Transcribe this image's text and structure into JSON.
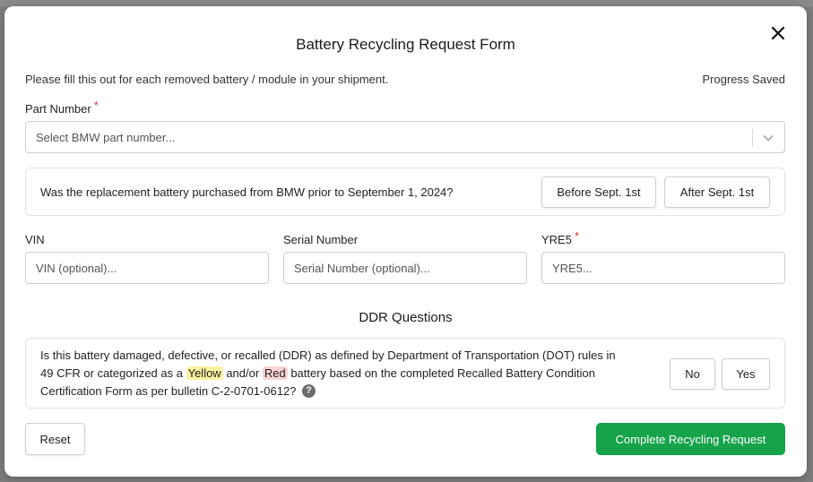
{
  "modal": {
    "title": "Battery Recycling Request Form",
    "subtitle": "Please fill this out for each removed battery / module in your shipment.",
    "progress": "Progress Saved"
  },
  "part_number": {
    "label": "Part Number",
    "required": "*",
    "placeholder": "Select BMW part number..."
  },
  "purchase_question": {
    "text": "Was the replacement battery purchased from BMW prior to September 1, 2024?",
    "before_label": "Before Sept. 1st",
    "after_label": "After Sept. 1st"
  },
  "vin": {
    "label": "VIN",
    "placeholder": "VIN (optional)..."
  },
  "serial": {
    "label": "Serial Number",
    "placeholder": "Serial Number (optional)..."
  },
  "yre5": {
    "label": "YRE5",
    "required": "*",
    "placeholder": "YRE5..."
  },
  "ddr": {
    "section_title": "DDR Questions",
    "line1": "Is this battery damaged, defective, or recalled (DDR) as defined by Department of Transportation (DOT) rules in",
    "line2_pre": "49 CFR or categorized as a",
    "yellow": "Yellow",
    "line2_mid": "and/or",
    "red": "Red",
    "line2_post": "battery based on the completed Recalled Battery Condition",
    "line3": "Certification Form as per bulletin C-2-0701-0612?",
    "help": "?",
    "no_label": "No",
    "yes_label": "Yes"
  },
  "footer": {
    "reset_label": "Reset",
    "submit_label": "Complete Recycling Request"
  },
  "colors": {
    "primary": "#16a34a",
    "required": "#dd3333",
    "yellow_highlight": "#fdf2a0",
    "red_highlight": "#fbd3d3"
  },
  "icons": {
    "close": "close-icon",
    "dropdown": "chevron-down-icon",
    "help": "help-circle-icon"
  }
}
